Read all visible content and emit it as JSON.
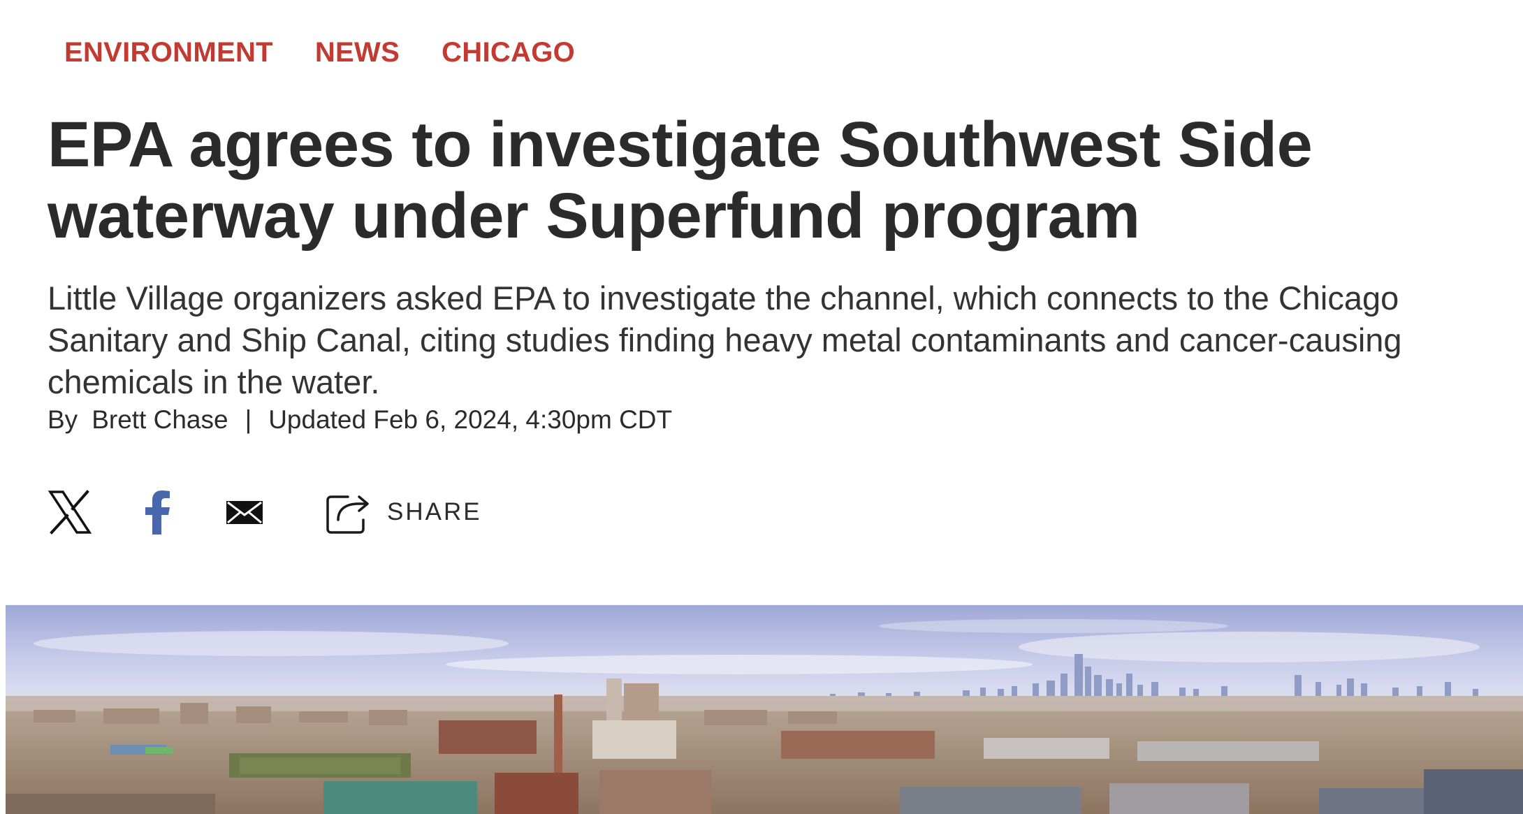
{
  "categories": [
    "Environment",
    "News",
    "Chicago"
  ],
  "headline": "EPA agrees to investigate Southwest Side waterway under Superfund program",
  "dek": "Little Village organizers asked EPA to investigate the channel, which connects to the Chicago Sanitary and Ship Canal, citing studies finding heavy metal contaminants and cancer-causing chemicals in the water.",
  "byline": {
    "prefix": "By",
    "author": "Brett Chase",
    "separator": "|",
    "updated": "Updated Feb 6, 2024, 4:30pm CDT"
  },
  "share": {
    "label": "SHARE",
    "icons": [
      "x-icon",
      "facebook-icon",
      "email-icon",
      "share-icon"
    ]
  },
  "colors": {
    "accent": "#c23b32",
    "text": "#2b2b2b",
    "facebook": "#4a67ad"
  }
}
